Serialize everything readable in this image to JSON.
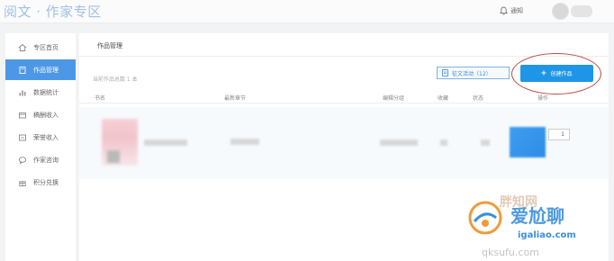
{
  "header": {
    "brand": "阅文 · 作家专区",
    "notice_label": "通知"
  },
  "sidebar": {
    "items": [
      {
        "label": "专区首页",
        "icon": "home-icon",
        "active": false
      },
      {
        "label": "作品管理",
        "icon": "book-icon",
        "active": true
      },
      {
        "label": "数据统计",
        "icon": "bar-chart-icon",
        "active": false
      },
      {
        "label": "稿酬收入",
        "icon": "wallet-icon",
        "active": false
      },
      {
        "label": "荣誉收入",
        "icon": "card-icon",
        "active": false
      },
      {
        "label": "作家咨询",
        "icon": "chat-icon",
        "active": false
      },
      {
        "label": "积分兑换",
        "icon": "gift-icon",
        "active": false
      }
    ]
  },
  "main": {
    "title": "作品管理",
    "count_text": "当前作品总数 1 本",
    "activity_button": "征文活动（12）",
    "create_button": "创建作品",
    "columns": [
      "书名",
      "最新章节",
      "编辑分组",
      "收藏",
      "状态",
      "操作"
    ],
    "row": {
      "action_value": "1"
    }
  },
  "watermark": {
    "text_top": "胖知网",
    "text_main": "爱尬聊",
    "url": "igaliao.com",
    "url2": "qksufu.com"
  },
  "colors": {
    "accent": "#4d98e6",
    "create_button": "#1f95e8",
    "annotation_circle": "#b84a45"
  }
}
